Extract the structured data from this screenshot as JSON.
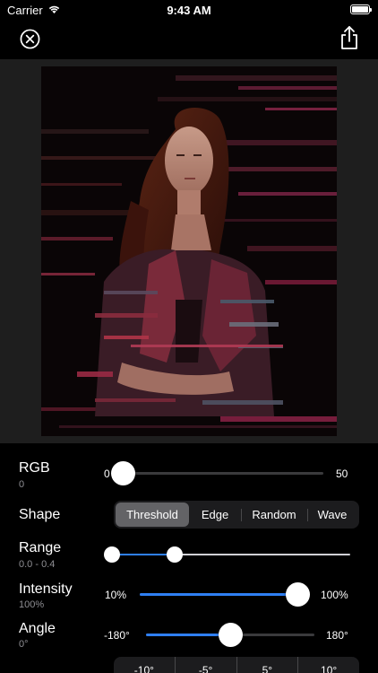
{
  "status_bar": {
    "carrier": "Carrier",
    "time": "9:43 AM"
  },
  "nav": {
    "close_icon": "close-circle-icon",
    "share_icon": "share-icon"
  },
  "controls": {
    "rgb": {
      "label": "RGB",
      "value": "0",
      "min_label": "0",
      "max_label": "50",
      "level": 0.0
    },
    "shape": {
      "label": "Shape",
      "options": [
        "Threshold",
        "Edge",
        "Random",
        "Wave"
      ],
      "selected": "Threshold"
    },
    "range": {
      "label": "Range",
      "value": "0.0 - 0.4",
      "low": 0.0,
      "high": 0.4
    },
    "intensity": {
      "label": "Intensity",
      "value": "100%",
      "min_label": "10%",
      "max_label": "100%",
      "level": 1.0
    },
    "angle": {
      "label": "Angle",
      "value": "0°",
      "min_label": "-180°",
      "max_label": "180°",
      "level": 0.5
    },
    "bottom_options": [
      "-10°",
      "-5°",
      "5°",
      "10°"
    ]
  },
  "colors": {
    "accent": "#2f7ff2",
    "background": "#000000",
    "panel": "#1e1e1e"
  }
}
